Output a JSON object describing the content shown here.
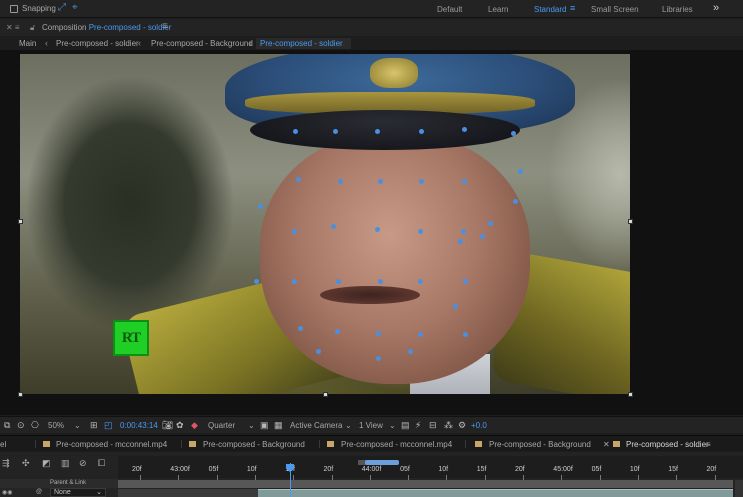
{
  "topbar": {
    "snapping_label": "Snapping",
    "workspaces": [
      "Default",
      "Learn",
      "Standard",
      "Small Screen",
      "Libraries"
    ],
    "active_workspace": "Standard"
  },
  "composition": {
    "panel_label": "Composition",
    "name": "Pre-composed - soldier",
    "breadcrumbs": [
      "Main",
      "Pre-composed - soldier",
      "Pre-composed - Background",
      "Pre-composed - soldier"
    ],
    "logo_text": "RT"
  },
  "viewer_toolbar": {
    "zoom": "50%",
    "timecode": "0:00:43:14",
    "resolution": "Quarter",
    "camera": "Active Camera",
    "views": "1 View",
    "exposure": "+0.0"
  },
  "timeline": {
    "tabs": [
      "el",
      "Pre-composed - mcconnel.mp4",
      "Pre-composed - Background",
      "Pre-composed - mcconnel.mp4",
      "Pre-composed - Background",
      "Pre-composed - soldier"
    ],
    "active_tab": "Pre-composed - soldier",
    "ruler_ticks": [
      "20f",
      "43:00f",
      "05f",
      "10f",
      "15f",
      "20f",
      "44:00f",
      "05f",
      "10f",
      "15f",
      "20f",
      "45:00f",
      "05f",
      "10f",
      "15f",
      "20f"
    ],
    "parent_link_label": "Parent & Link",
    "parent_value": "None"
  },
  "colors": {
    "accent": "#4a9af0",
    "tracker_point": "#4a8fe0",
    "logo_green": "#1fcf26",
    "tab_square": "#c8a56a"
  }
}
